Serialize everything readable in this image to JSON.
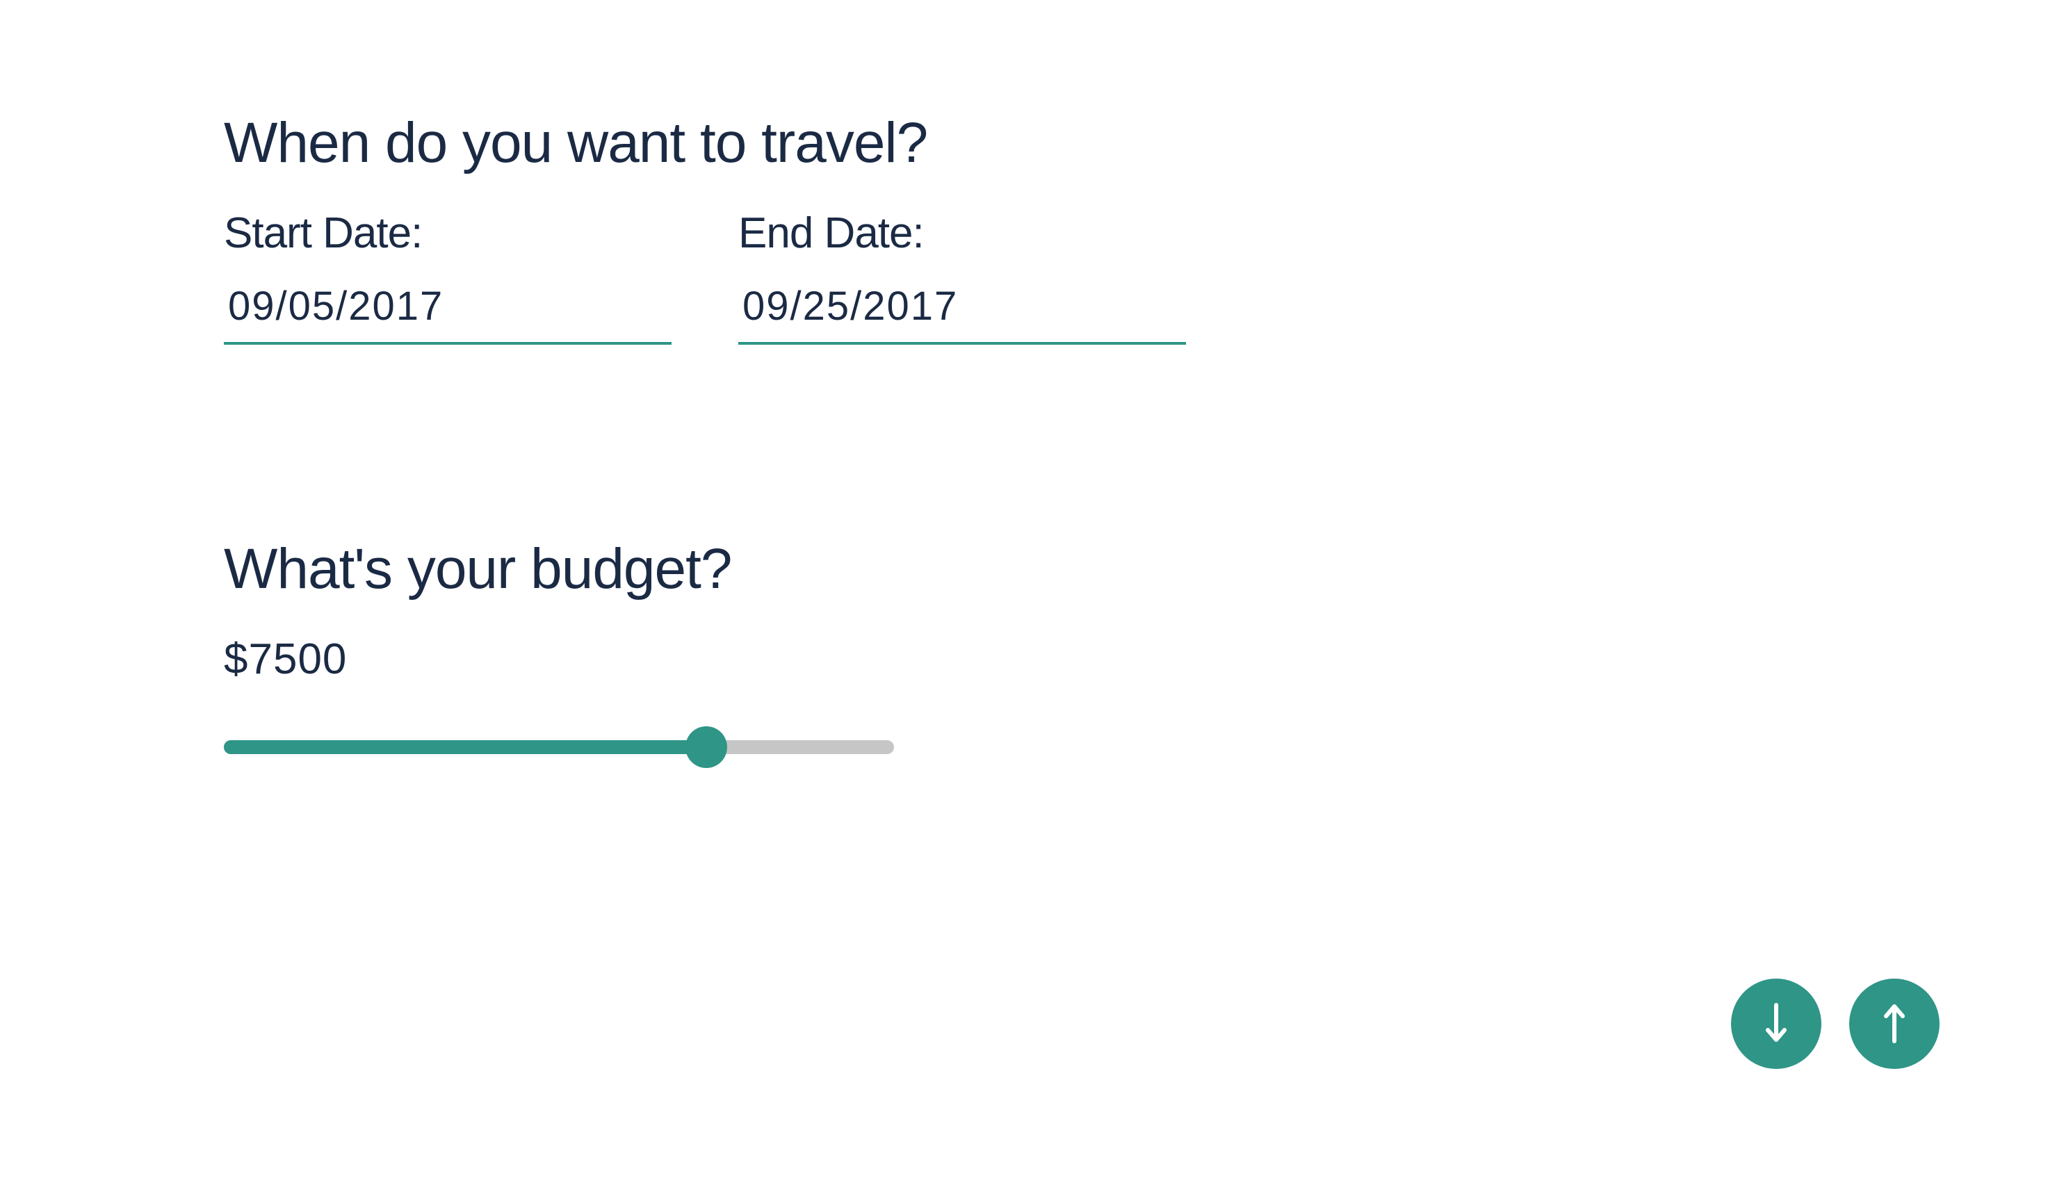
{
  "travel": {
    "heading": "When do you want to travel?",
    "start_label": "Start Date:",
    "start_value": "09/05/2017",
    "end_label": "End Date:",
    "end_value": "09/25/2017"
  },
  "budget": {
    "heading": "What's your budget?",
    "value_text": "$7500",
    "slider_fraction": 0.72
  },
  "navigation": {
    "down_icon": "arrow-down-icon",
    "up_icon": "arrow-up-icon"
  },
  "colors": {
    "accent": "#2e9587",
    "text": "#1b2a44",
    "track": "#c6c6c6",
    "background": "#ffffff"
  }
}
